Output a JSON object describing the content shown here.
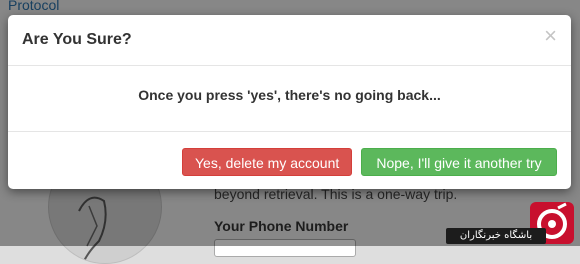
{
  "background": {
    "link_text": "Protocol",
    "description_fragment": "beyond retrieval. This is a one-way trip.",
    "phone_label": "Your Phone Number"
  },
  "modal": {
    "title": "Are You Sure?",
    "close_symbol": "×",
    "message": "Once you press 'yes', there's no going back...",
    "confirm_label": "Yes, delete my account",
    "cancel_label": "Nope, I'll give it another try"
  },
  "watermark": {
    "text": "باشگاه خبرنگاران"
  },
  "colors": {
    "danger": "#d9534f",
    "success": "#5cb85c",
    "link": "#2a6ea6",
    "watermark_red": "#c8102e"
  },
  "icons": {
    "close": "close-icon",
    "watermark_logo": "agency-logo-icon"
  }
}
